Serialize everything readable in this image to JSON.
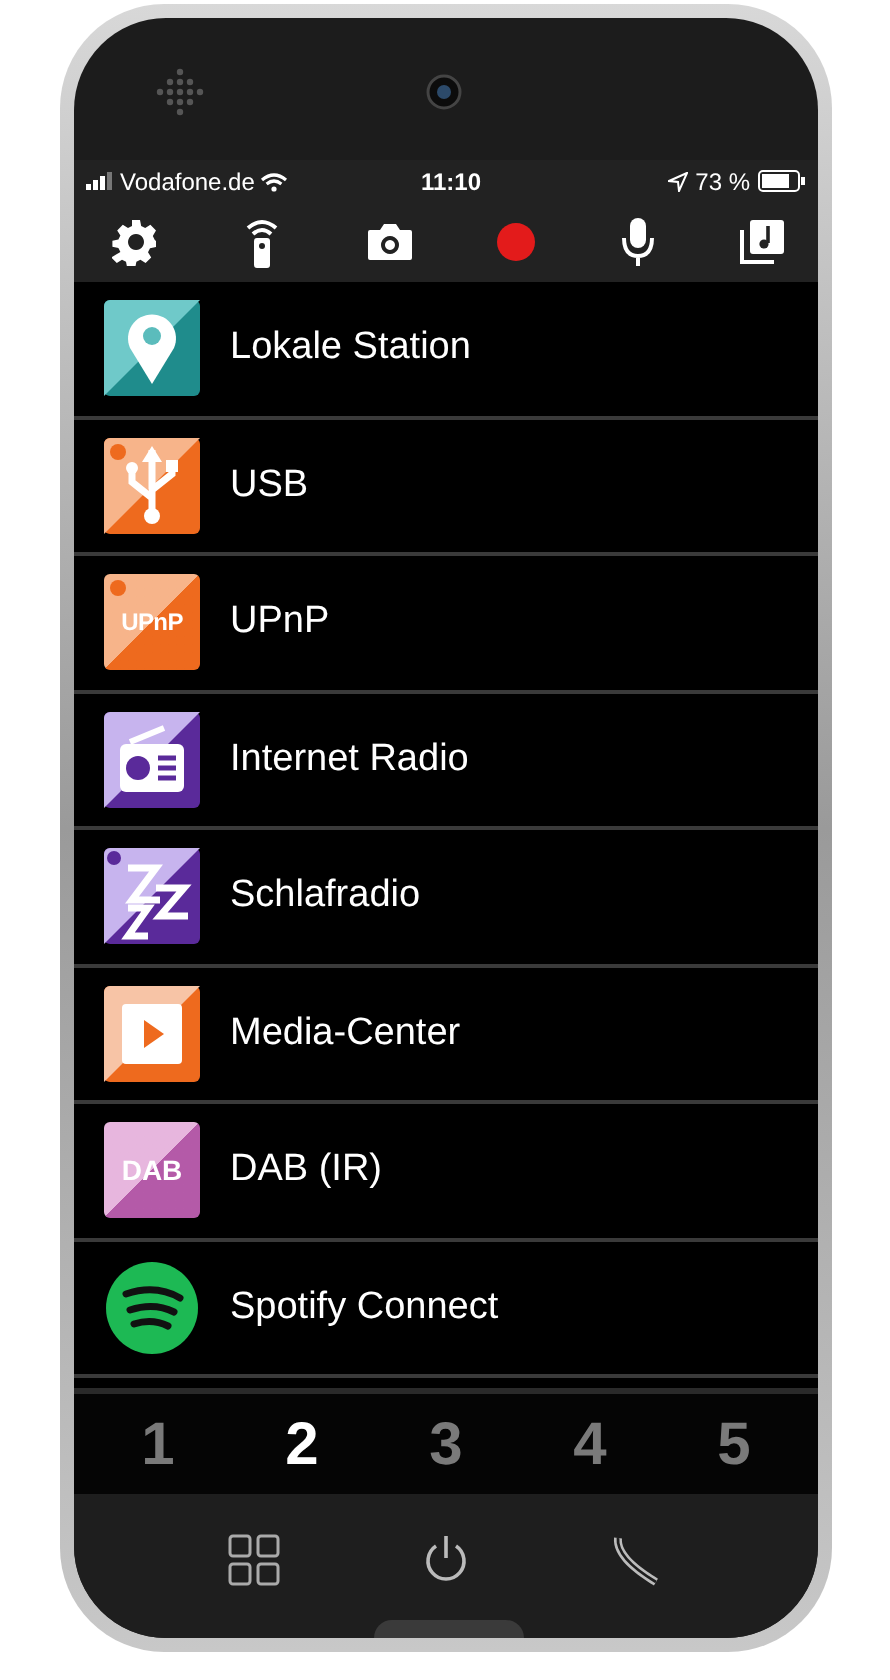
{
  "status_bar": {
    "carrier": "Vodafone.de",
    "time": "11:10",
    "battery": "73 %"
  },
  "sources": [
    {
      "kind": "location",
      "label": "Lokale Station"
    },
    {
      "kind": "usb",
      "label": "USB"
    },
    {
      "kind": "upnp",
      "label": "UPnP",
      "icon_text": "UPnP"
    },
    {
      "kind": "radio",
      "label": "Internet Radio"
    },
    {
      "kind": "sleep",
      "label": "Schlafradio"
    },
    {
      "kind": "media",
      "label": "Media-Center"
    },
    {
      "kind": "dab",
      "label": "DAB (IR)",
      "icon_text": "DAB"
    },
    {
      "kind": "spotify",
      "label": "Spotify Connect"
    }
  ],
  "presets": [
    {
      "label": "1",
      "selected": false
    },
    {
      "label": "2",
      "selected": true
    },
    {
      "label": "3",
      "selected": false
    },
    {
      "label": "4",
      "selected": false
    },
    {
      "label": "5",
      "selected": false
    }
  ]
}
